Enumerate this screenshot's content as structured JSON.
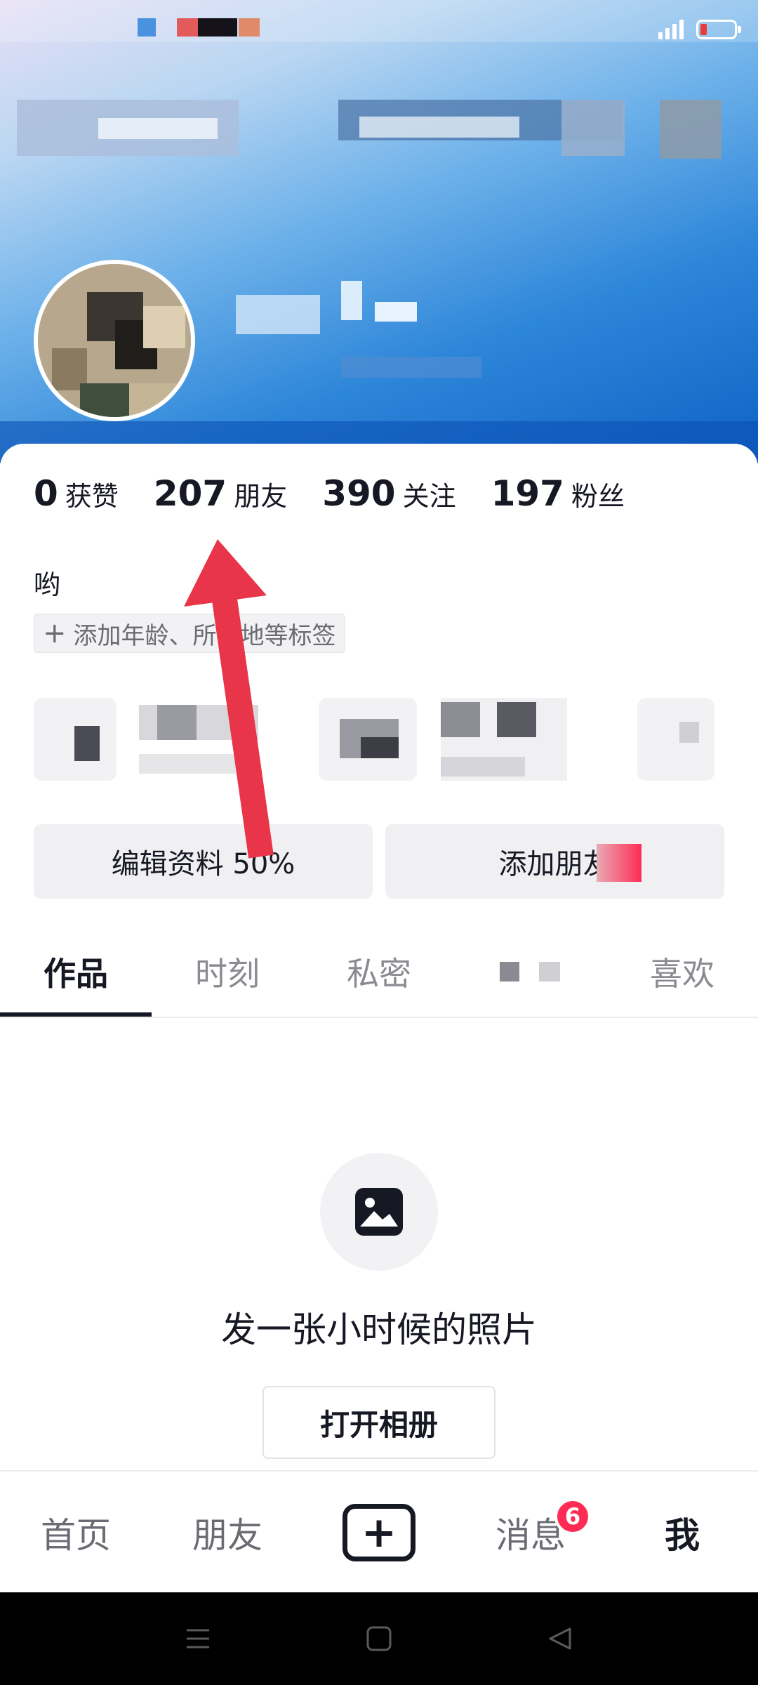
{
  "stats": [
    {
      "value": "0",
      "label": "获赞"
    },
    {
      "value": "207",
      "label": "朋友"
    },
    {
      "value": "390",
      "label": "关注"
    },
    {
      "value": "197",
      "label": "粉丝"
    }
  ],
  "profile": {
    "bio": "哟",
    "add_tag_label": "添加年龄、所在地等标签"
  },
  "buttons": {
    "edit_profile": "编辑资料 50%",
    "add_friends": "添加朋友"
  },
  "tabs": [
    {
      "label": "作品",
      "active": true
    },
    {
      "label": "时刻",
      "active": false
    },
    {
      "label": "私密",
      "active": false
    },
    {
      "label": "",
      "active": false
    },
    {
      "label": "喜欢",
      "active": false
    }
  ],
  "empty_state": {
    "icon": "image-icon",
    "title": "发一张小时候的照片",
    "button": "打开相册"
  },
  "bottom_nav": {
    "home": "首页",
    "friends": "朋友",
    "create": "+",
    "messages": "消息",
    "messages_badge": "6",
    "me": "我"
  },
  "colors": {
    "accent": "#fe2c55",
    "annotation_arrow": "#e8354a",
    "text_primary": "#161823",
    "text_secondary": "#8a8b91"
  }
}
